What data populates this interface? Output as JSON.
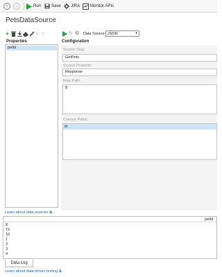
{
  "toolbar": {
    "run_label": "Run",
    "save_label": "Save",
    "jira_label": "JIRA",
    "monitor_label": "Monitor APIs"
  },
  "page": {
    "title": "PetsDataSource"
  },
  "properties": {
    "heading": "Properties",
    "items": [
      "petId"
    ]
  },
  "configuration": {
    "heading": "Configuration",
    "data_source_label": "Data Source:",
    "data_source_value": "JSON",
    "source_step_label": "Source Step:",
    "source_step_value": "GetPets",
    "source_property_label": "Source Property:",
    "source_property_value": "Response",
    "row_path_label": "Row Path:",
    "row_path_value": "$",
    "column_paths_label": "Column Paths:",
    "column_paths": [
      "id"
    ]
  },
  "links": {
    "learn_data_sources": "Learn about data sources",
    "learn_data_driven": "Learn about data-driven testing"
  },
  "grid": {
    "column_header": "petId",
    "rows": [
      "8",
      "72",
      "10",
      "1",
      "3",
      "3",
      "4"
    ]
  },
  "bottom_tab": {
    "label": "Data Log"
  },
  "colors": {
    "accent_green": "#22a33a",
    "selection_blue": "#cfe3f6",
    "link_blue": "#1c65b6"
  }
}
